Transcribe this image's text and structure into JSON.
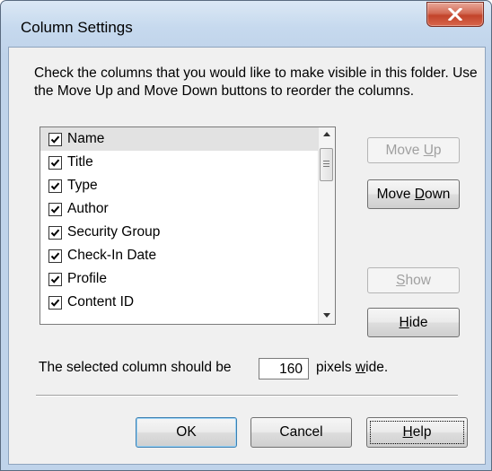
{
  "window": {
    "title": "Column Settings"
  },
  "description": "Check the columns that you would like to make visible in this folder.  Use the Move Up and Move Down buttons to reorder the columns.",
  "columns": [
    {
      "label": "Name",
      "checked": true,
      "selected": true
    },
    {
      "label": "Title",
      "checked": true,
      "selected": false
    },
    {
      "label": "Type",
      "checked": true,
      "selected": false
    },
    {
      "label": "Author",
      "checked": true,
      "selected": false
    },
    {
      "label": "Security Group",
      "checked": true,
      "selected": false
    },
    {
      "label": "Check-In Date",
      "checked": true,
      "selected": false
    },
    {
      "label": "Profile",
      "checked": true,
      "selected": false
    },
    {
      "label": "Content ID",
      "checked": true,
      "selected": false
    }
  ],
  "buttons": {
    "move_up": {
      "pre": "Move ",
      "key": "U",
      "post": "p",
      "enabled": false
    },
    "move_down": {
      "pre": "Move ",
      "key": "D",
      "post": "own",
      "enabled": true
    },
    "show": {
      "pre": "",
      "key": "S",
      "post": "how",
      "enabled": false
    },
    "hide": {
      "pre": "",
      "key": "H",
      "post": "ide",
      "enabled": true
    },
    "ok": {
      "label": "OK"
    },
    "cancel": {
      "label": "Cancel"
    },
    "help": {
      "pre": "",
      "key": "H",
      "post": "elp"
    }
  },
  "width_setting": {
    "prefix": "The selected column should be",
    "value": "160",
    "suffix_pre": "pixels ",
    "suffix_key": "w",
    "suffix_post": "ide."
  },
  "icons": {
    "close": "close-x-icon",
    "checkbox": "checkmark-icon",
    "scroll_up": "triangle-up-icon",
    "scroll_down": "triangle-down-icon"
  },
  "colors": {
    "title_bar": "#c6d9ee",
    "close_button": "#c2442b",
    "dialog_bg": "#f0f0f0",
    "selected_row": "#e2e2e2",
    "disabled_text": "#a0a0a0",
    "default_button_border": "#3c7fb1"
  }
}
